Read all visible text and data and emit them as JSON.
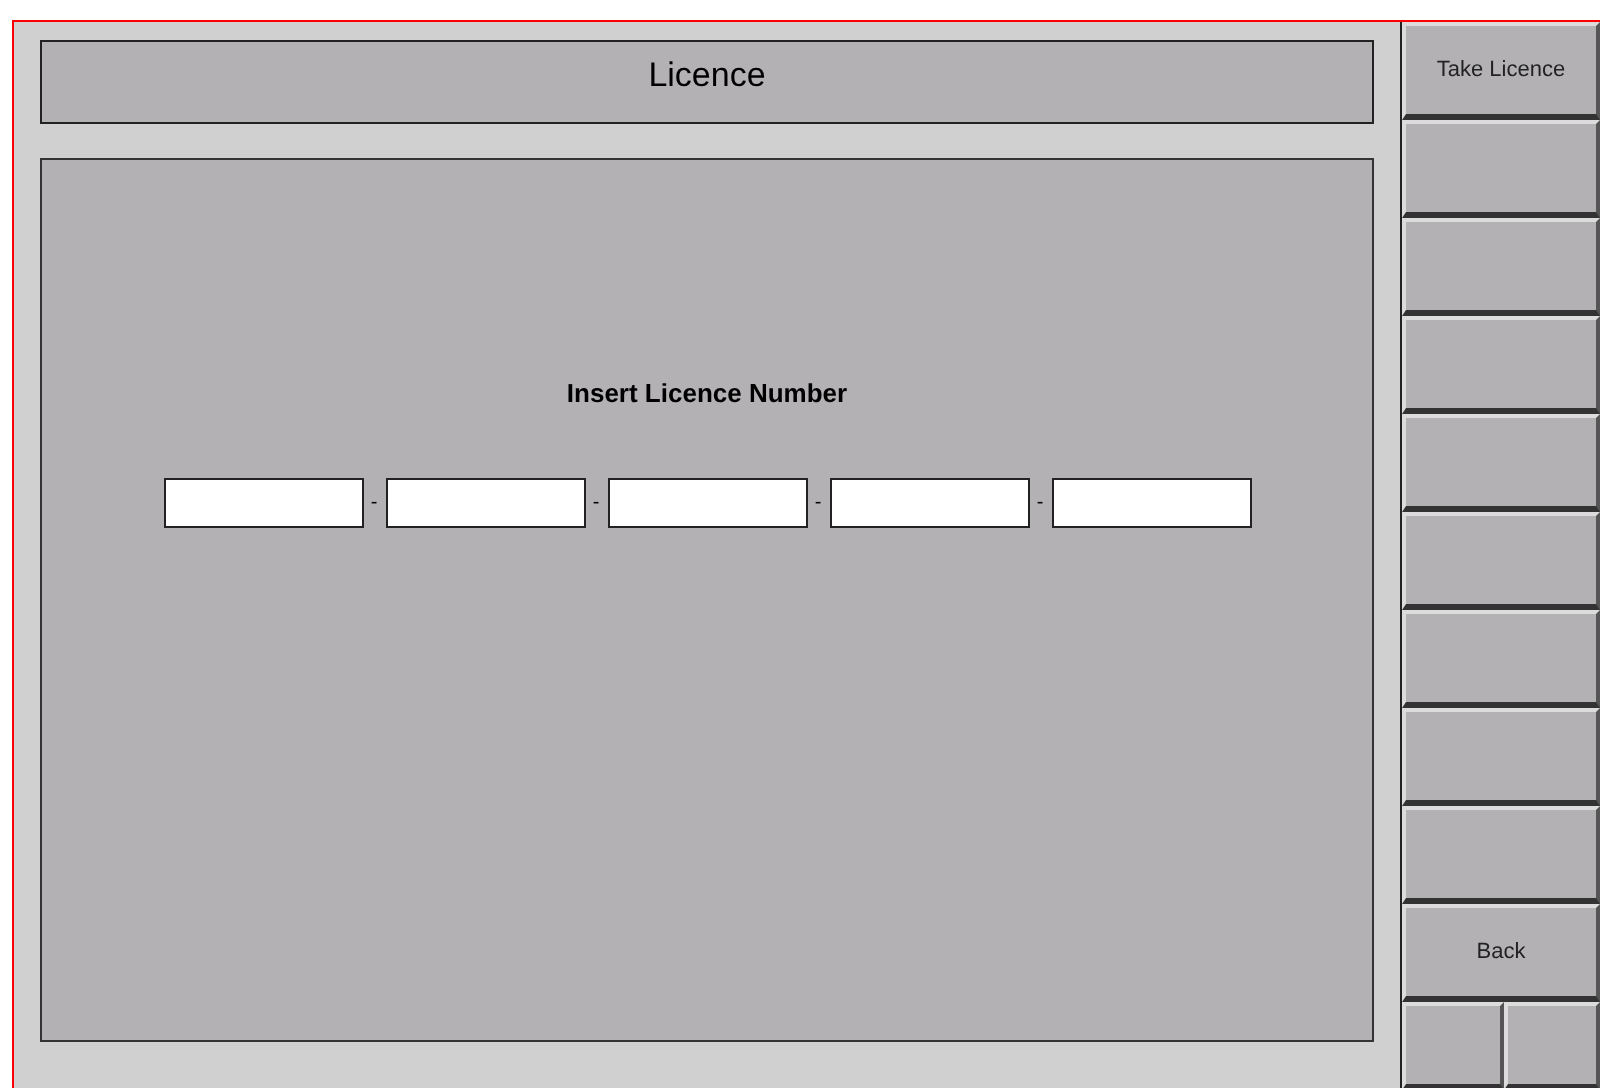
{
  "header": {
    "title": "Licence"
  },
  "form": {
    "prompt": "Insert Licence Number",
    "fields": [
      {
        "kind": "text"
      },
      {
        "kind": "text"
      },
      {
        "kind": "text"
      },
      {
        "kind": "text"
      },
      {
        "kind": "text"
      }
    ],
    "separator": "-"
  },
  "side_buttons": [
    {
      "kind": "labeled",
      "label": "Take Licence"
    },
    {
      "kind": "blank"
    },
    {
      "kind": "blank"
    },
    {
      "kind": "blank"
    },
    {
      "kind": "blank"
    },
    {
      "kind": "blank"
    },
    {
      "kind": "blank"
    },
    {
      "kind": "blank"
    },
    {
      "kind": "blank"
    },
    {
      "kind": "labeled",
      "label": "Back"
    },
    {
      "kind": "split"
    }
  ]
}
